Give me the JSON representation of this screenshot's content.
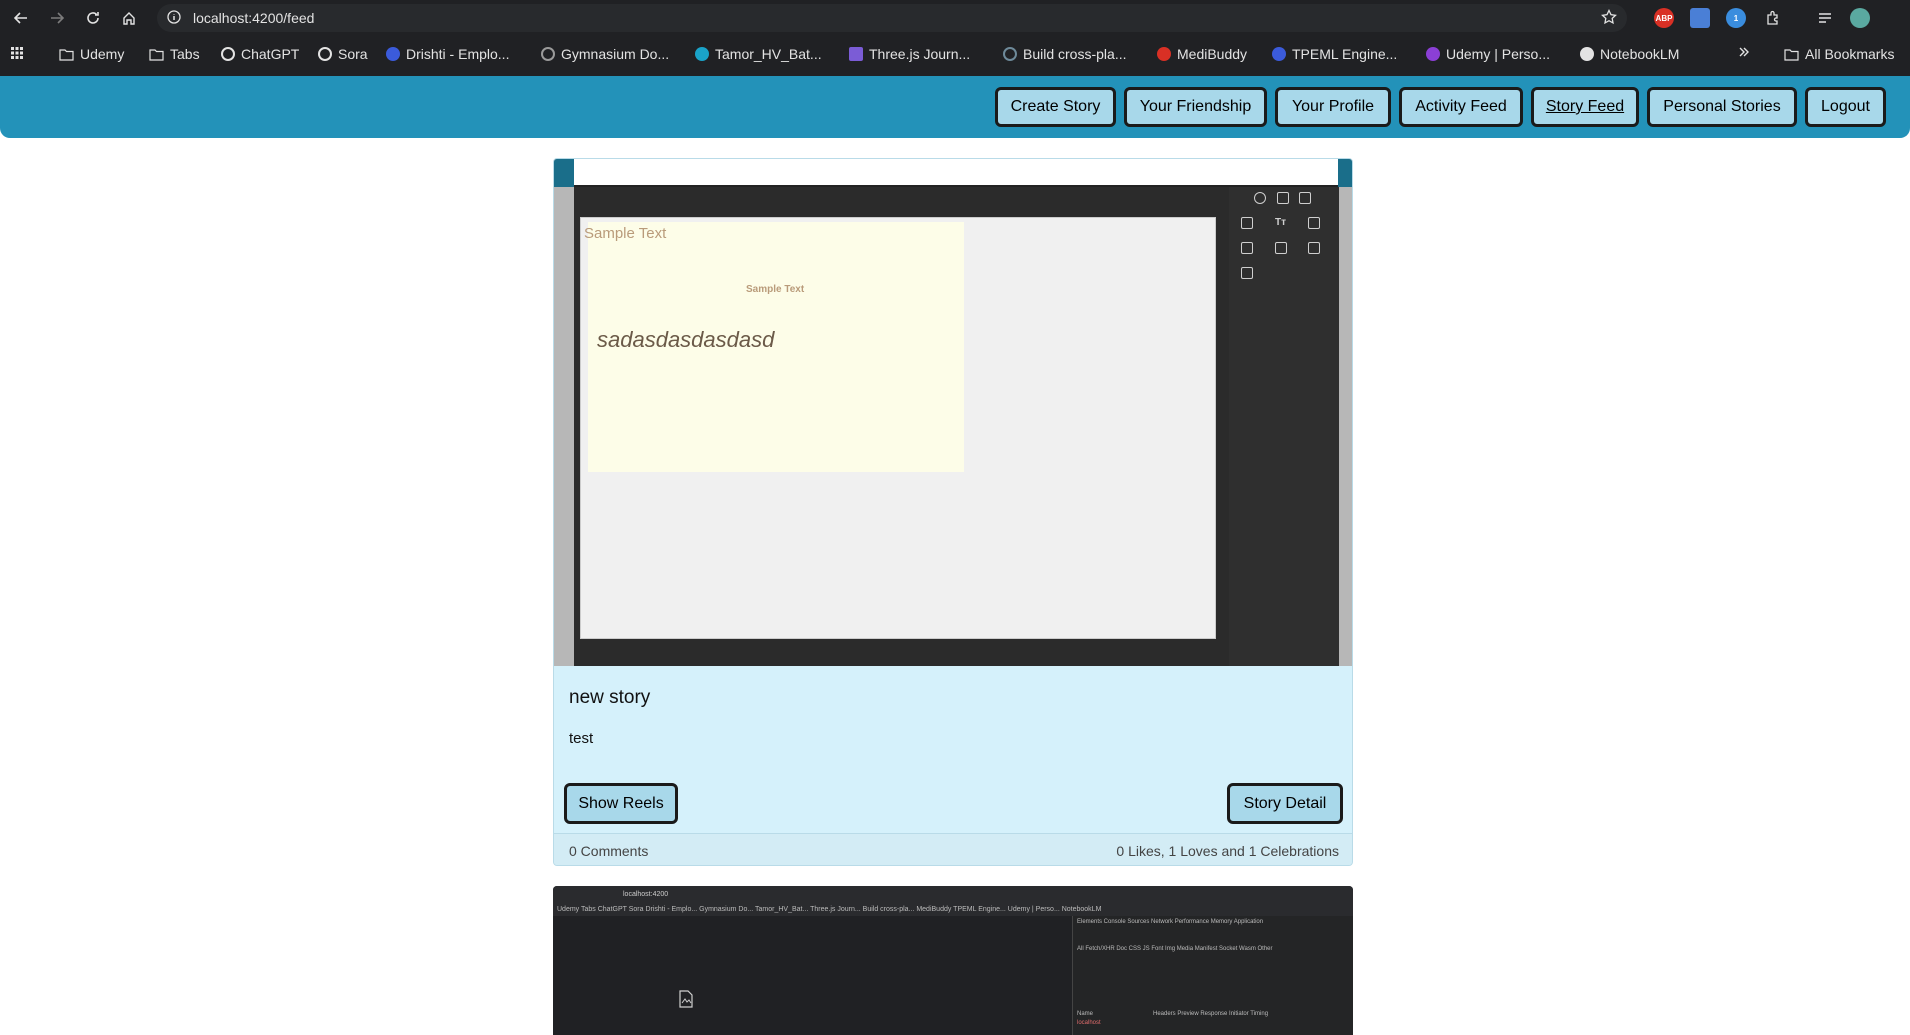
{
  "browser": {
    "url": "localhost:4200/feed",
    "bookmarks": [
      "Udemy",
      "Tabs",
      "ChatGPT",
      "Sora",
      "Drishti - Emplo...",
      "Gymnasium Do...",
      "Tamor_HV_Bat...",
      "Three.js Journ...",
      "Build cross-pla...",
      "MediBuddy",
      "TPEML Engine...",
      "Udemy | Perso...",
      "NotebookLM"
    ],
    "all_bookmarks": "All Bookmarks",
    "ext_badge": "1",
    "abp": "ABP"
  },
  "nav": {
    "items": [
      "Create Story",
      "Your Friendship",
      "Your Profile",
      "Activity Feed",
      "Story Feed",
      "Personal Stories",
      "Logout"
    ],
    "active": "Story Feed"
  },
  "story": {
    "image": {
      "text_top": "Sample Text",
      "text_small": "Sample Text",
      "text_main": "sadasdasdasdasd"
    },
    "title": "new story",
    "description": "test",
    "show_reels": "Show Reels",
    "story_detail": "Story Detail",
    "comments": "0 Comments",
    "reactions": "0 Likes, 1 Loves and 1 Celebrations"
  },
  "story2": {
    "mini_url": "localhost:4200",
    "mini_bookmarks": "Udemy  Tabs  ChatGPT  Sora  Drishti - Emplo...  Gymnasium Do...  Tamor_HV_Bat...  Three.js Journ...  Build cross-pla...  MediBuddy  TPEML Engine...  Udemy | Perso...  NotebookLM",
    "devtools_tabs": "Elements  Console  Sources  Network  Performance  Memory  Application",
    "devtools_filters": "All  Fetch/XHR  Doc  CSS  JS  Font  Img  Media  Manifest  Socket  Wasm  Other",
    "devtools_panel": "Headers  Preview  Response  Initiator  Timing",
    "devtools_name": "Name",
    "devtools_item": "localhost"
  }
}
